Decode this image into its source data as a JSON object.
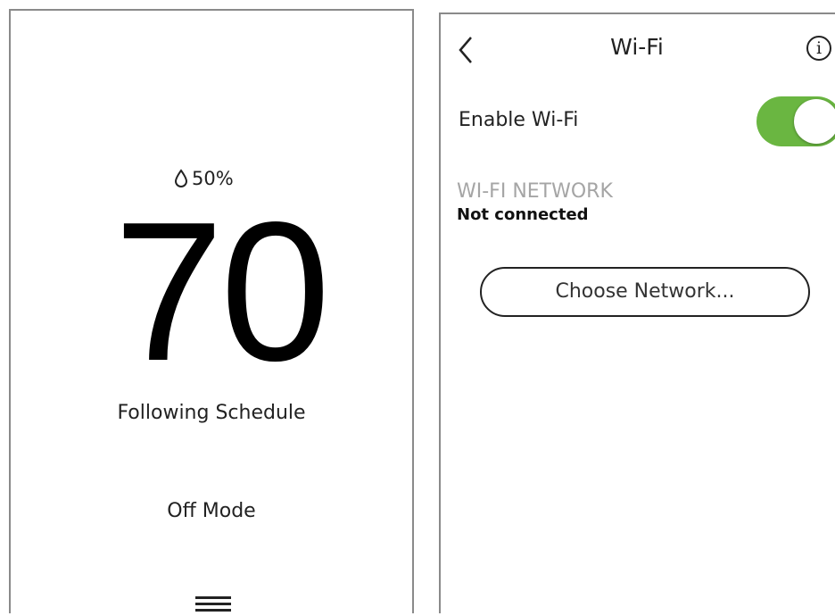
{
  "thermostat": {
    "humidity": "50%",
    "humidity_icon": "droplet-icon",
    "temperature": "70",
    "schedule_status": "Following Schedule",
    "mode": "Off Mode",
    "menu_icon": "hamburger-menu-icon"
  },
  "wifi": {
    "title": "Wi-Fi",
    "back_icon": "chevron-left-icon",
    "info_icon": "info-icon",
    "info_glyph": "i",
    "enable_label": "Enable Wi-Fi",
    "enabled": true,
    "toggle_color": "#6ab641",
    "network_heading": "WI-FI NETWORK",
    "network_status": "Not connected",
    "choose_button": "Choose Network..."
  }
}
